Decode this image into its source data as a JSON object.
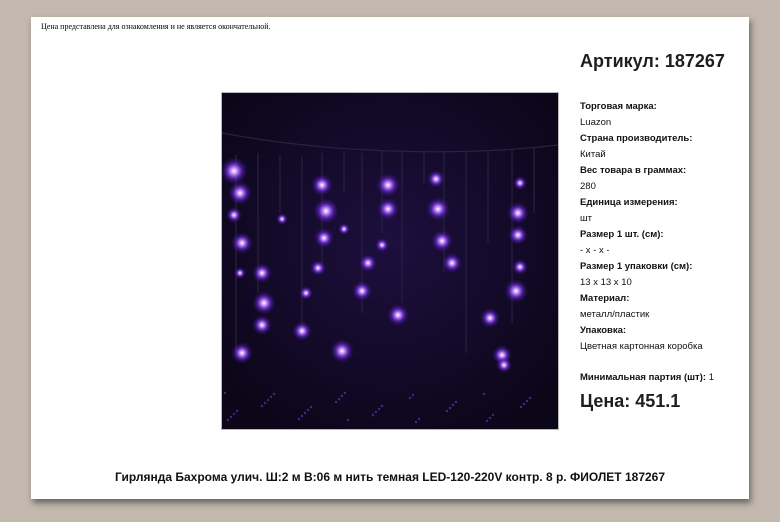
{
  "disclaimer": "Цена представлена для ознакомления и не является окончательной.",
  "article": "Артикул: 187267",
  "specs": [
    {
      "label": "Торговая марка:",
      "value": "Luazon"
    },
    {
      "label": "Страна производитель:",
      "value": "Китай"
    },
    {
      "label": "Вес товара в граммах:",
      "value": "280"
    },
    {
      "label": "Единица измерения:",
      "value": "шт"
    },
    {
      "label": "Размер 1 шт. (см):",
      "value": "- x - x -"
    },
    {
      "label": "Размер 1 упаковки (см):",
      "value": "13 x 13 x 10"
    },
    {
      "label": "Материал:",
      "value": "металл/пластик"
    },
    {
      "label": "Упаковка:",
      "value": "Цветная картонная коробка"
    }
  ],
  "min_party": {
    "label": "Минимальная партия (шт):",
    "value": "1"
  },
  "price": "Цена: 451.1",
  "product_title": "Гирлянда Бахрома улич. Ш:2 м В:06 м нить темная LED-120-220V контр. 8 р. ФИОЛЕТ 187267",
  "colors": {
    "page_bg": "#c2b8ad",
    "photo_bg": "#100923",
    "led_glow": "#9b46ff"
  }
}
